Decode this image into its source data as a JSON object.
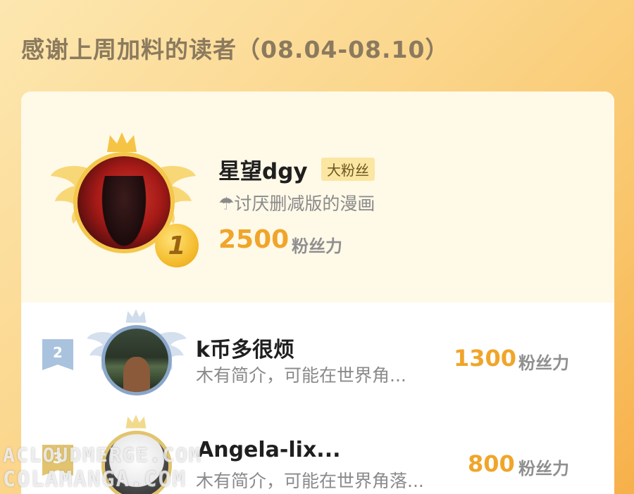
{
  "header": {
    "title": "感谢上周加料的读者（08.04-08.10）"
  },
  "ranking": {
    "first": {
      "rank": "1",
      "name": "星望dgy",
      "tag": "大粉丝",
      "bio": "☂讨厌删减版的漫画",
      "score": "2500",
      "unit": "粉丝力"
    },
    "rows": [
      {
        "rank": "2",
        "name": "k币多很烦",
        "bio": "木有简介，可能在世界角...",
        "score": "1300",
        "unit": "粉丝力"
      },
      {
        "rank": "3",
        "name": "Angela-lix...",
        "bio": "木有简介，可能在世界角落...",
        "score": "800",
        "unit": "粉丝力"
      }
    ]
  },
  "watermark": {
    "line1": "ACLOUDMERGE.COM",
    "line2": "COLAMANGA.COM"
  },
  "colors": {
    "gold": "#f0a52a",
    "silver": "#a9c2de",
    "bronze": "#e2c46f"
  }
}
